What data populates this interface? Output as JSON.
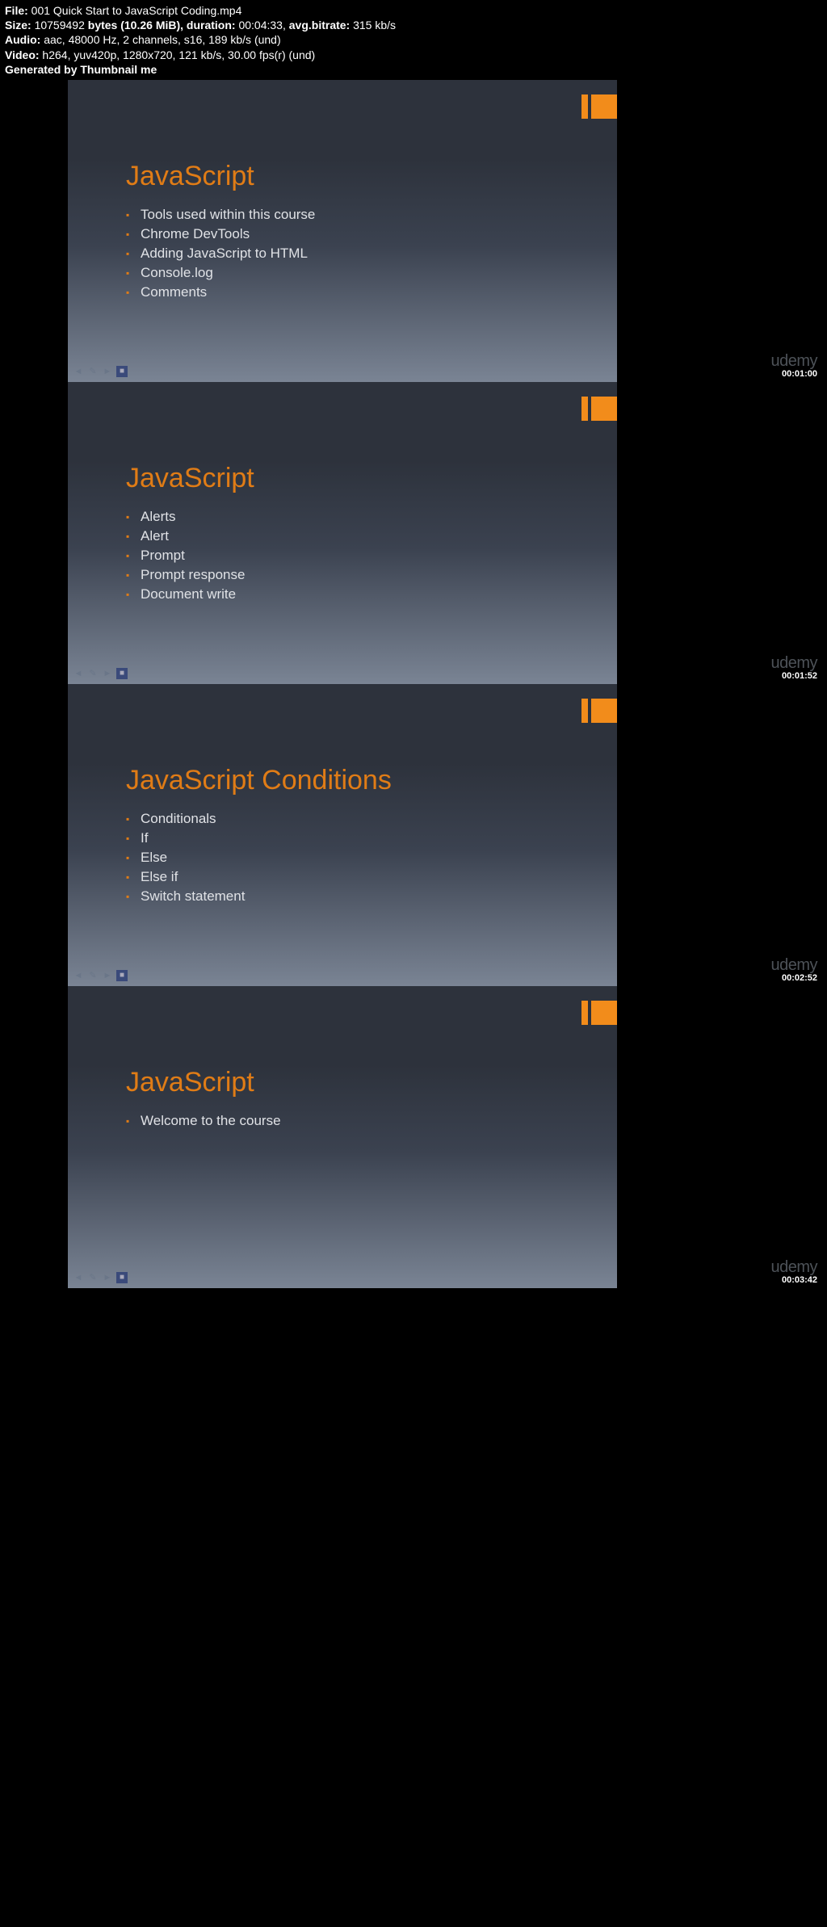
{
  "header": {
    "file_label": "File:",
    "file_value": "001 Quick Start to JavaScript Coding.mp4",
    "size_label": "Size:",
    "size_bytes": "10759492",
    "size_text": "bytes (10.26 MiB), duration:",
    "duration": "00:04:33,",
    "avg_label": "avg.bitrate:",
    "avg_value": "315 kb/s",
    "audio_label": "Audio:",
    "audio_value": "aac, 48000 Hz, 2 channels, s16, 189 kb/s (und)",
    "video_label": "Video:",
    "video_value": "h264, yuv420p, 1280x720, 121 kb/s, 30.00 fps(r) (und)",
    "generated": "Generated by Thumbnail me"
  },
  "watermark": "udemy",
  "slides": [
    {
      "title": "JavaScript",
      "items": [
        "Tools used within this course",
        "Chrome DevTools",
        "Adding JavaScript to HTML",
        "Console.log",
        "Comments"
      ],
      "timestamp": "00:01:00"
    },
    {
      "title": "JavaScript",
      "items": [
        "Alerts",
        "Alert",
        "Prompt",
        "Prompt response",
        "Document write"
      ],
      "timestamp": "00:01:52"
    },
    {
      "title": "JavaScript Conditions",
      "items": [
        "Conditionals",
        "If",
        "Else",
        "Else if",
        "Switch statement"
      ],
      "timestamp": "00:02:52"
    },
    {
      "title": "JavaScript",
      "items": [
        "Welcome to the course"
      ],
      "timestamp": "00:03:42"
    }
  ]
}
